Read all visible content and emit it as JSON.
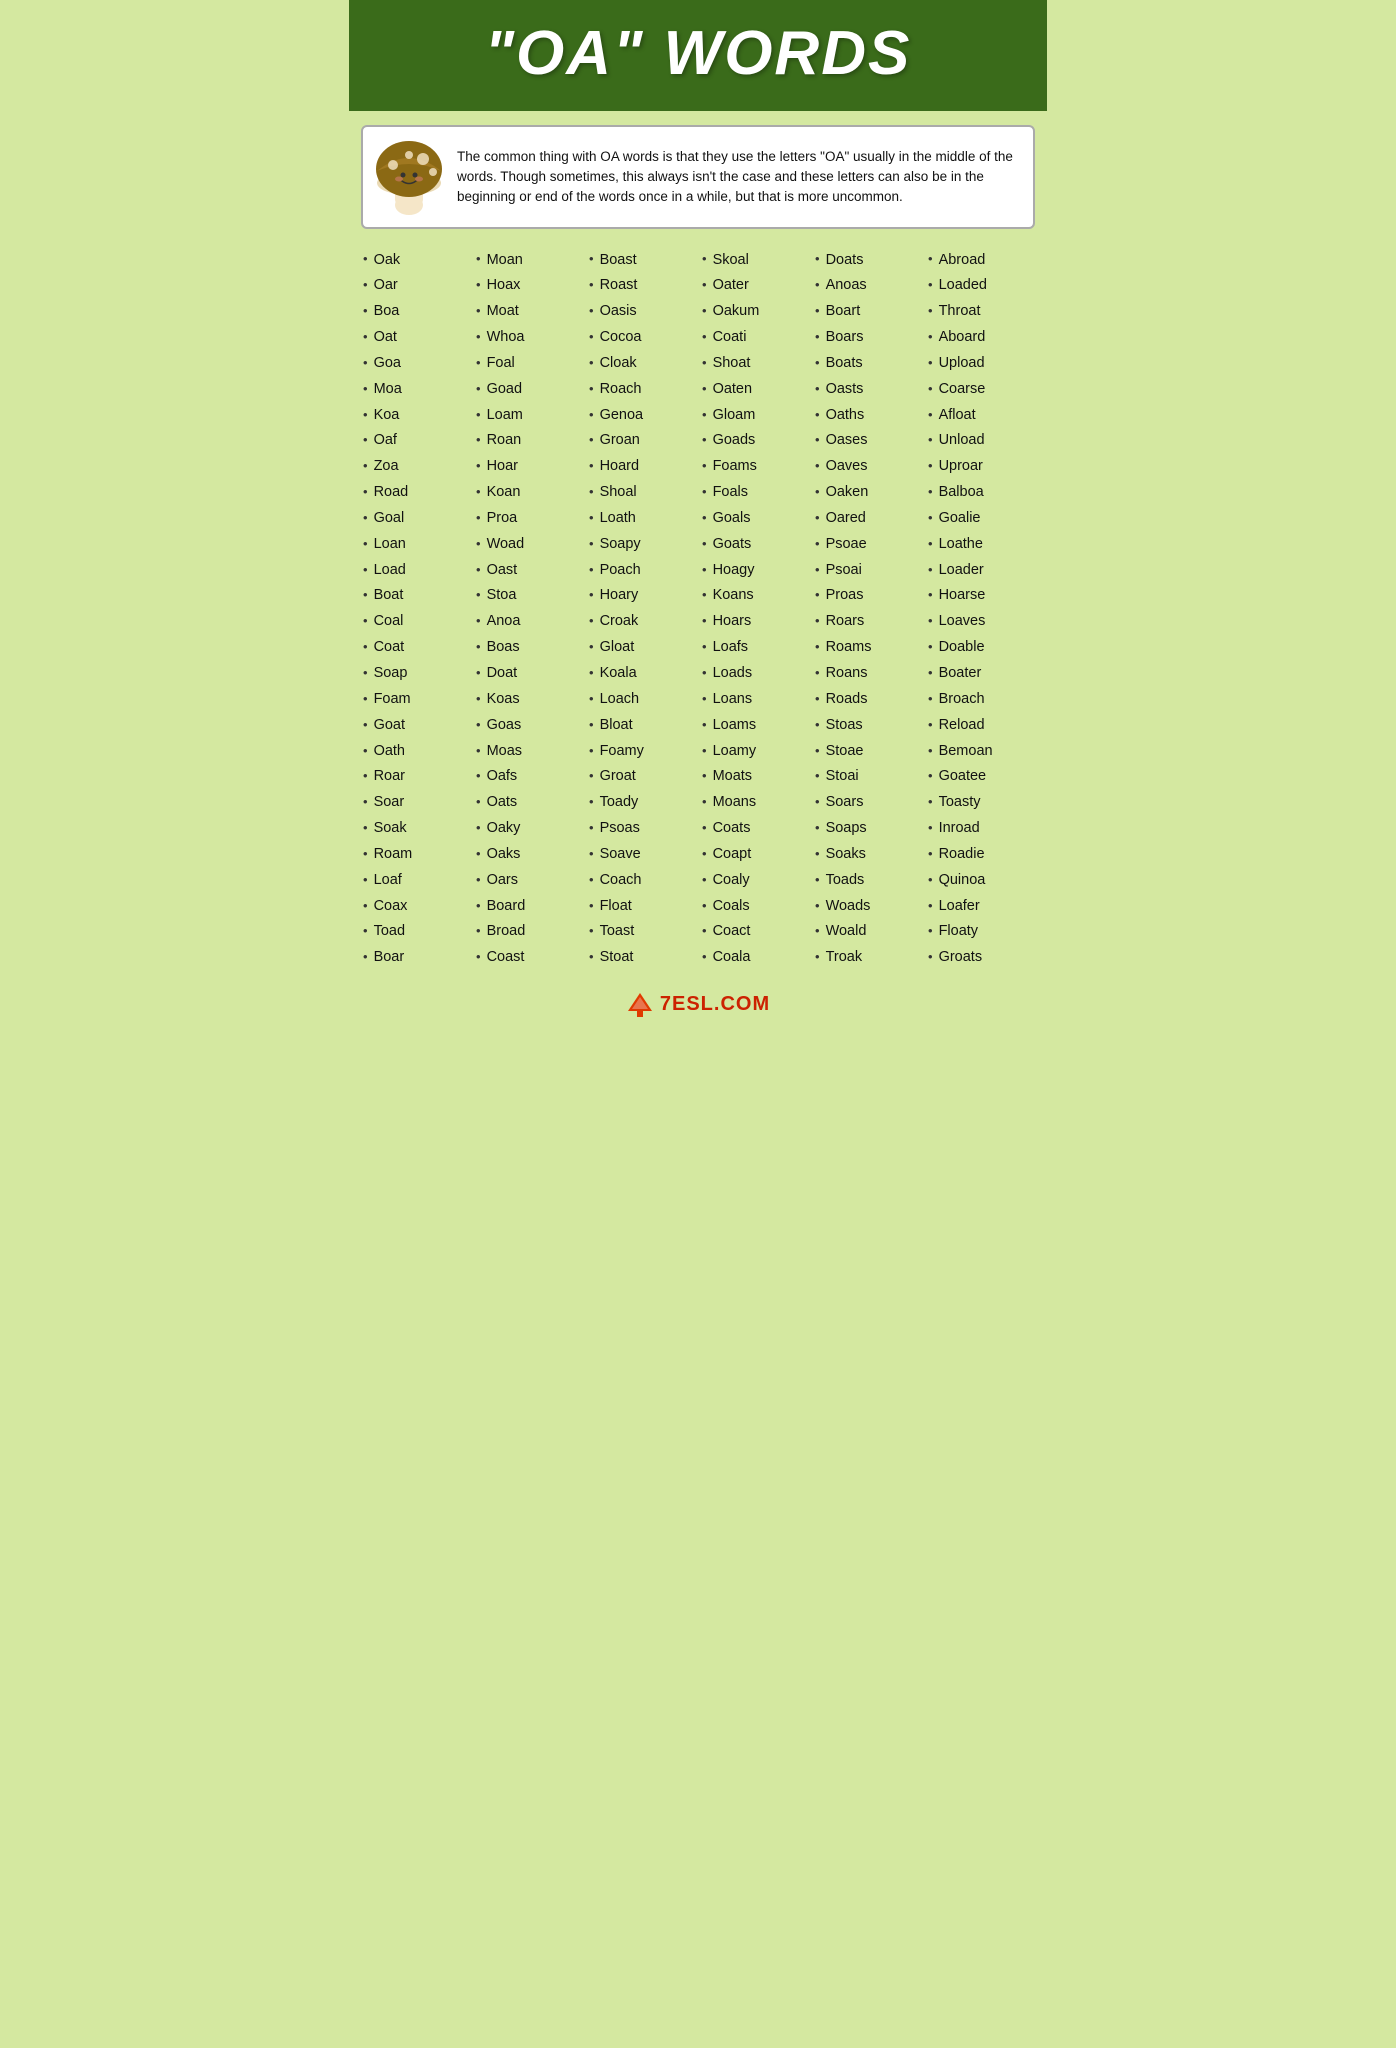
{
  "header": {
    "title": "\"OA\" WORDS"
  },
  "intro": {
    "text": "The common thing with OA words is that they use the letters \"OA\" usually in the middle of the words. Though sometimes, this always isn't the case and these letters can also be in the beginning or end of the words once in a while, but that is more uncommon."
  },
  "columns": [
    {
      "id": "col1",
      "words": [
        "Oak",
        "Oar",
        "Boa",
        "Oat",
        "Goa",
        "Moa",
        "Koa",
        "Oaf",
        "Zoa",
        "Road",
        "Goal",
        "Loan",
        "Load",
        "Boat",
        "Coal",
        "Coat",
        "Soap",
        "Foam",
        "Goat",
        "Oath",
        "Roar",
        "Soar",
        "Soak",
        "Roam",
        "Loaf",
        "Coax",
        "Toad",
        "Boar"
      ]
    },
    {
      "id": "col2",
      "words": [
        "Moan",
        "Hoax",
        "Moat",
        "Whoa",
        "Foal",
        "Goad",
        "Loam",
        "Roan",
        "Hoar",
        "Koan",
        "Proa",
        "Woad",
        "Oast",
        "Stoa",
        "Anoa",
        "Boas",
        "Doat",
        "Koas",
        "Goas",
        "Moas",
        "Oafs",
        "Oats",
        "Oaky",
        "Oaks",
        "Oars",
        "Board",
        "Broad",
        "Coast"
      ]
    },
    {
      "id": "col3",
      "words": [
        "Boast",
        "Roast",
        "Oasis",
        "Cocoa",
        "Cloak",
        "Roach",
        "Genoa",
        "Groan",
        "Hoard",
        "Shoal",
        "Loath",
        "Soapy",
        "Poach",
        "Hoary",
        "Croak",
        "Gloat",
        "Koala",
        "Loach",
        "Bloat",
        "Foamy",
        "Groat",
        "Toady",
        "Psoas",
        "Soave",
        "Coach",
        "Float",
        "Toast",
        "Stoat"
      ]
    },
    {
      "id": "col4",
      "words": [
        "Skoal",
        "Oater",
        "Oakum",
        "Coati",
        "Shoat",
        "Oaten",
        "Gloam",
        "Goads",
        "Foams",
        "Foals",
        "Goals",
        "Goats",
        "Hoagy",
        "Koans",
        "Hoars",
        "Loafs",
        "Loads",
        "Loans",
        "Loams",
        "Loamy",
        "Moats",
        "Moans",
        "Coats",
        "Coapt",
        "Coaly",
        "Coals",
        "Coact",
        "Coala"
      ]
    },
    {
      "id": "col5",
      "words": [
        "Doats",
        "Anoas",
        "Boart",
        "Boars",
        "Boats",
        "Oasts",
        "Oaths",
        "Oases",
        "Oaves",
        "Oaken",
        "Oared",
        "Psoae",
        "Psoai",
        "Proas",
        "Roars",
        "Roams",
        "Roans",
        "Roads",
        "Stoas",
        "Stoae",
        "Stoai",
        "Soars",
        "Soaps",
        "Soaks",
        "Toads",
        "Woads",
        "Woald",
        "Troak"
      ]
    },
    {
      "id": "col6",
      "words": [
        "Abroad",
        "Loaded",
        "Throat",
        "Aboard",
        "Upload",
        "Coarse",
        "Afloat",
        "Unload",
        "Uproar",
        "Balboa",
        "Goalie",
        "Loathe",
        "Loader",
        "Hoarse",
        "Loaves",
        "Doable",
        "Boater",
        "Broach",
        "Reload",
        "Bemoan",
        "Goatee",
        "Toasty",
        "Inroad",
        "Roadie",
        "Quinoa",
        "Loafer",
        "Floaty",
        "Groats"
      ]
    }
  ],
  "footer": {
    "logo_text": "7ESL.COM"
  }
}
